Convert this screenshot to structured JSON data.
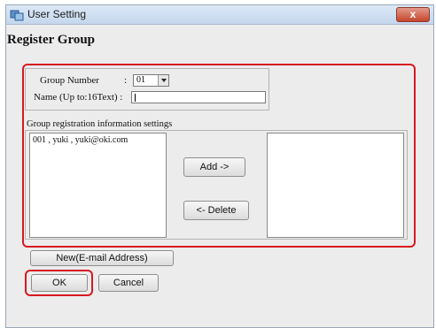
{
  "window": {
    "title": "User Setting",
    "close_label": "x"
  },
  "dialog": {
    "heading": "Register Group",
    "group_number_label": "Group Number",
    "group_number_colon": ":",
    "group_number_value": "01",
    "name_label": "Name (Up to:16Text) :",
    "name_value": "",
    "registration_section_label": "Group registration information settings",
    "available_entries": [
      "001 , yuki , yuki@oki.com"
    ],
    "selected_entries": [],
    "add_button": "Add ->",
    "delete_button": "<- Delete",
    "new_email_button": "New(E-mail Address)",
    "ok_button": "OK",
    "cancel_button": "Cancel"
  },
  "colors": {
    "highlight": "#d71920",
    "window_bg": "#ececec",
    "titlebar": "#c5d7ee",
    "close_button": "#c6452c"
  },
  "icons": {
    "app": "user-setting-icon",
    "close": "close-icon",
    "dropdown": "chevron-down-icon"
  }
}
